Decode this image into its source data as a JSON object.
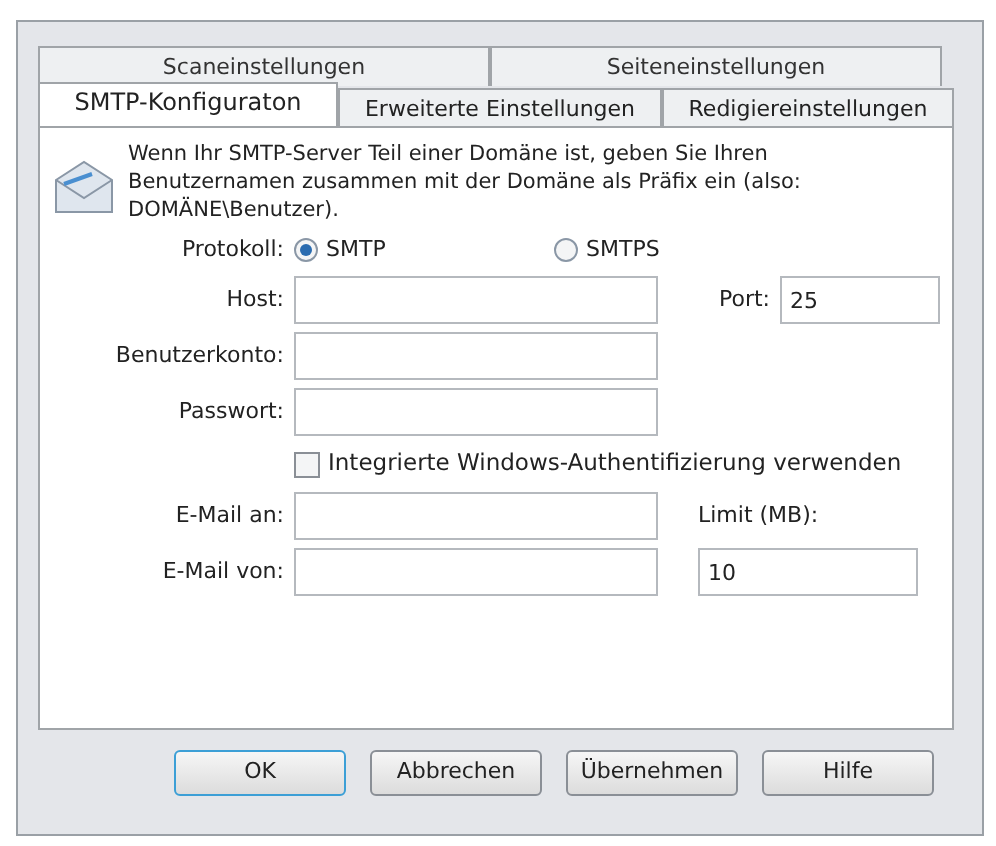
{
  "tabs_back": [
    {
      "label": "Scaneinstellungen",
      "selected": false
    },
    {
      "label": "Seiteneinstellungen",
      "selected": false
    }
  ],
  "tabs_front": [
    {
      "label": "SMTP-Konfiguraton",
      "selected": true
    },
    {
      "label": "Erweiterte Einstellungen",
      "selected": false
    },
    {
      "label": "Redigiereinstellungen",
      "selected": false
    }
  ],
  "info": "Wenn Ihr SMTP-Server Teil einer Domäne ist, geben Sie Ihren Benutzernamen zusammen mit der Domäne als Präfix ein (also: DOMÄNE\\Benutzer).",
  "protocol": {
    "label": "Protokoll:",
    "options": [
      {
        "label": "SMTP",
        "selected": true
      },
      {
        "label": "SMTPS",
        "selected": false
      }
    ]
  },
  "host": {
    "label": "Host:"
  },
  "port": {
    "label": "Port:",
    "value": "25"
  },
  "account": {
    "label": "Benutzerkonto:"
  },
  "password": {
    "label": "Passwort:"
  },
  "windows_auth": {
    "label": "Integrierte Windows-Authentifizierung verwenden",
    "checked": false
  },
  "email_to": {
    "label": "E-Mail an:"
  },
  "limit": {
    "label": "Limit (MB):",
    "value": "10"
  },
  "email_from": {
    "label": "E-Mail von:"
  },
  "buttons": [
    {
      "label": "OK",
      "default": true
    },
    {
      "label": "Abbrechen",
      "default": false
    },
    {
      "label": "Übernehmen",
      "default": false
    },
    {
      "label": "Hilfe",
      "default": false
    }
  ]
}
